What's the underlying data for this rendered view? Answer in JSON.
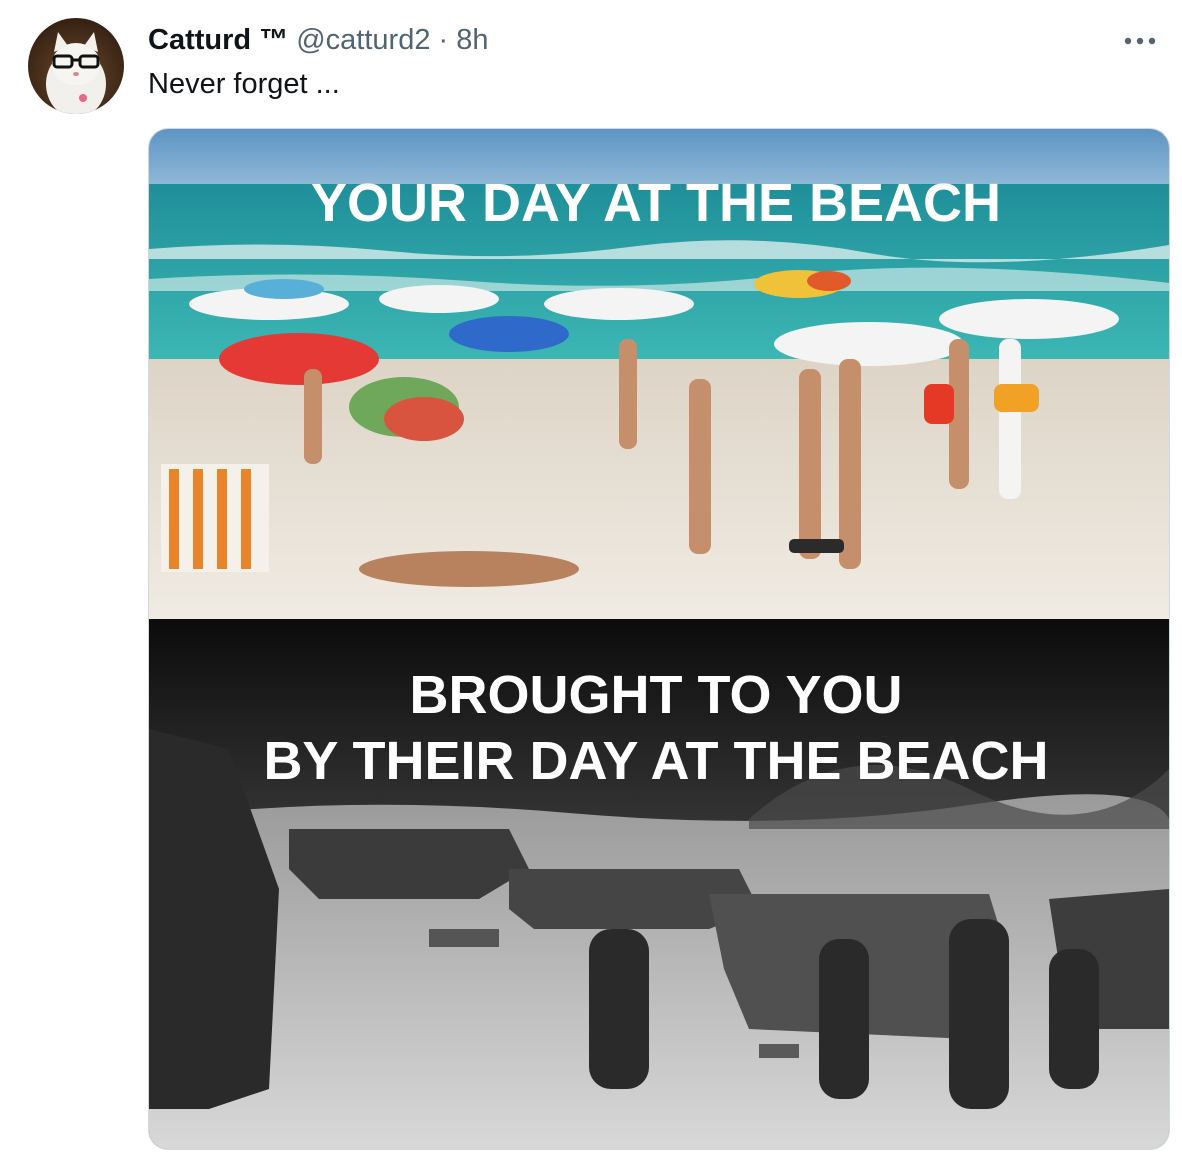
{
  "tweet": {
    "author_name": "Catturd ™",
    "handle": "@catturd2",
    "separator": "·",
    "time": "8h",
    "text": "Never forget ...",
    "more_icon": "more-horizontal-icon"
  },
  "media": {
    "top_caption": "YOUR DAY AT THE BEACH",
    "bottom_caption_line1": "BROUGHT TO YOU",
    "bottom_caption_line2": "BY THEIR DAY AT THE BEACH"
  },
  "colors": {
    "text_primary": "#0f1419",
    "text_secondary": "#536471",
    "border": "#cfd9de"
  }
}
